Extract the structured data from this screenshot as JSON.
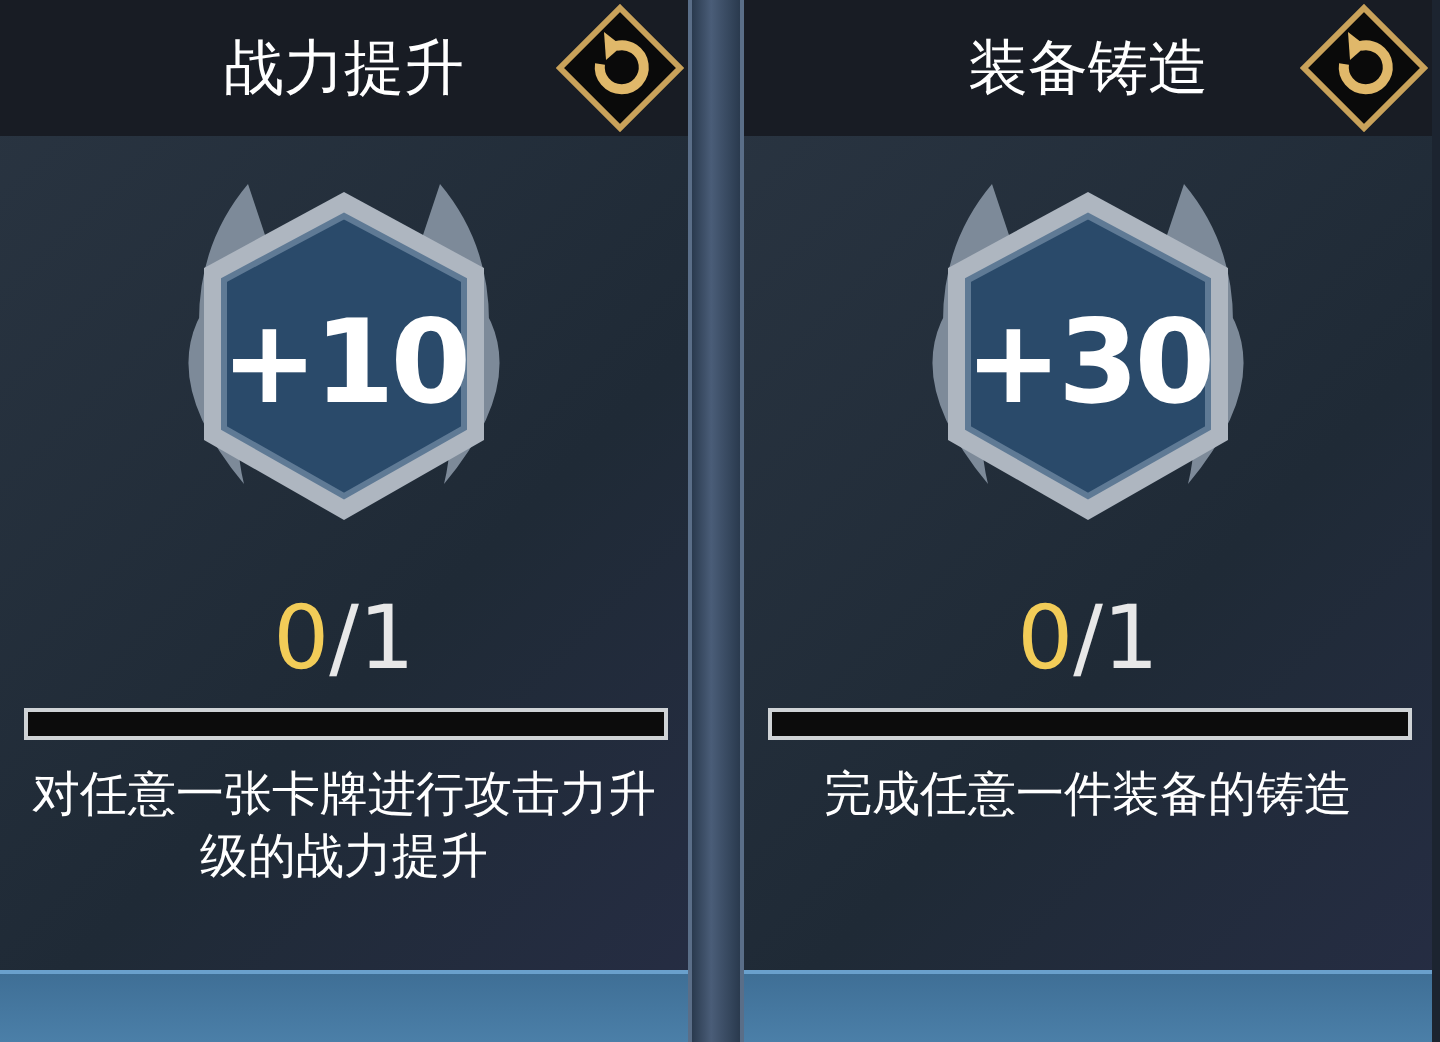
{
  "cards": [
    {
      "title": "战力提升",
      "reward": "+10",
      "progress_done": "0",
      "progress_total": "/1",
      "level": 0,
      "description": "对任意一张卡牌进行攻击力升级的战力提升"
    },
    {
      "title": "装备铸造",
      "reward": "+30",
      "progress_done": "0",
      "progress_total": "/1",
      "level": 0,
      "description": "完成任意一件装备的铸造"
    }
  ]
}
